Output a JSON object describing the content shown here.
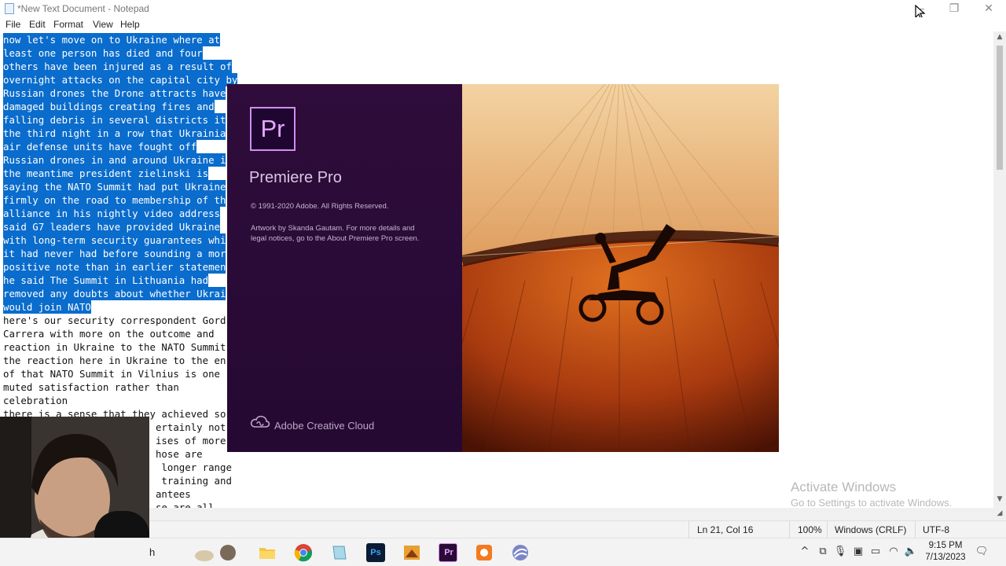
{
  "window": {
    "title": "*New Text Document - Notepad",
    "controls": {
      "minimize": "—",
      "maximize": "❐",
      "close": "✕"
    }
  },
  "menu": [
    "File",
    "Edit",
    "Format",
    "View",
    "Help"
  ],
  "editor_lines": [
    {
      "text": "now let's move on to Ukraine where at",
      "selected": true
    },
    {
      "text": "least one person has died and four",
      "selected": true
    },
    {
      "text": "others have been injured as a result of",
      "selected": true
    },
    {
      "text": "overnight attacks on the capital city by",
      "selected": true
    },
    {
      "text": "Russian drones the Drone attracts have",
      "selected": true
    },
    {
      "text": "damaged buildings creating fires and",
      "selected": true
    },
    {
      "text": "falling debris in several districts it",
      "selected": true
    },
    {
      "text": "the third night in a row that Ukrainia",
      "selected": true
    },
    {
      "text": "air defense units have fought off",
      "selected": true
    },
    {
      "text": "Russian drones in and around Ukraine i",
      "selected": true
    },
    {
      "text": "the meantime president zielinski is",
      "selected": true
    },
    {
      "text": "saying the NATO Summit had put Ukraine",
      "selected": true
    },
    {
      "text": "firmly on the road to membership of th",
      "selected": true
    },
    {
      "text": "alliance in his nightly video address",
      "selected": true
    },
    {
      "text": "said G7 leaders have provided Ukraine",
      "selected": true
    },
    {
      "text": "with long-term security guarantees whi",
      "selected": true
    },
    {
      "text": "it had never had before sounding a mor",
      "selected": true
    },
    {
      "text": "positive note than in earlier statemen",
      "selected": true
    },
    {
      "text": "he said The Summit in Lithuania had",
      "selected": true
    },
    {
      "text": "removed any doubts about whether Ukrai",
      "selected": true
    },
    {
      "text": "would join NATO",
      "selected": true
    },
    {
      "text": "here's our security correspondent Gord",
      "selected": false
    },
    {
      "text": "Carrera with more on the outcome and",
      "selected": false
    },
    {
      "text": "reaction in Ukraine to the NATO Summit",
      "selected": false
    },
    {
      "text": "the reaction here in Ukraine to the en",
      "selected": false
    },
    {
      "text": "of that NATO Summit in Vilnius is one",
      "selected": false
    },
    {
      "text": "muted satisfaction rather than",
      "selected": false
    },
    {
      "text": "celebration",
      "selected": false
    },
    {
      "text": "there is a sense that they achieved so",
      "selected": false
    },
    {
      "text": "                          ertainly not",
      "selected": false
    },
    {
      "text": "                          ises of more",
      "selected": false
    },
    {
      "text": "                          hose are",
      "selected": false
    },
    {
      "text": "                           longer range",
      "selected": false
    },
    {
      "text": "                           training and",
      "selected": false
    },
    {
      "text": "                          antees",
      "selected": false
    },
    {
      "text": "                          se are all",
      "selected": false
    }
  ],
  "splash": {
    "logo": "Pr",
    "app_name": "Premiere Pro",
    "copyright": "© 1991-2020 Adobe. All Rights Reserved.",
    "artwork": "Artwork by Skanda Gautam. For more details and legal notices, go to the About Premiere Pro screen.",
    "footer": "Adobe Creative Cloud"
  },
  "watermark": {
    "heading": "Activate Windows",
    "subtext": "Go to Settings to activate Windows."
  },
  "status": {
    "position": "Ln 21, Col 16",
    "zoom": "100%",
    "line_ending": "Windows (CRLF)",
    "encoding": "UTF-8"
  },
  "taskbar": {
    "search_fragment": "h",
    "apps": [
      {
        "name": "File Explorer",
        "icon": "folder-icon"
      },
      {
        "name": "Google Chrome",
        "icon": "chrome-icon"
      },
      {
        "name": "Notepad",
        "icon": "notepad-icon"
      },
      {
        "name": "Photoshop",
        "icon": "photoshop-icon",
        "label": "Ps"
      },
      {
        "name": "Illustration app",
        "icon": "paint-icon"
      },
      {
        "name": "Premiere Pro",
        "icon": "premiere-icon",
        "label": "Pr"
      },
      {
        "name": "Orange app",
        "icon": "orange-app-icon"
      },
      {
        "name": "Globe app",
        "icon": "globe-app-icon"
      }
    ],
    "time": "9:15 PM",
    "date": "7/13/2023"
  },
  "colors": {
    "selection": "#0a6ccc",
    "premiere_purple": "#2f0c3b",
    "premiere_accent": "#d28cf0"
  }
}
